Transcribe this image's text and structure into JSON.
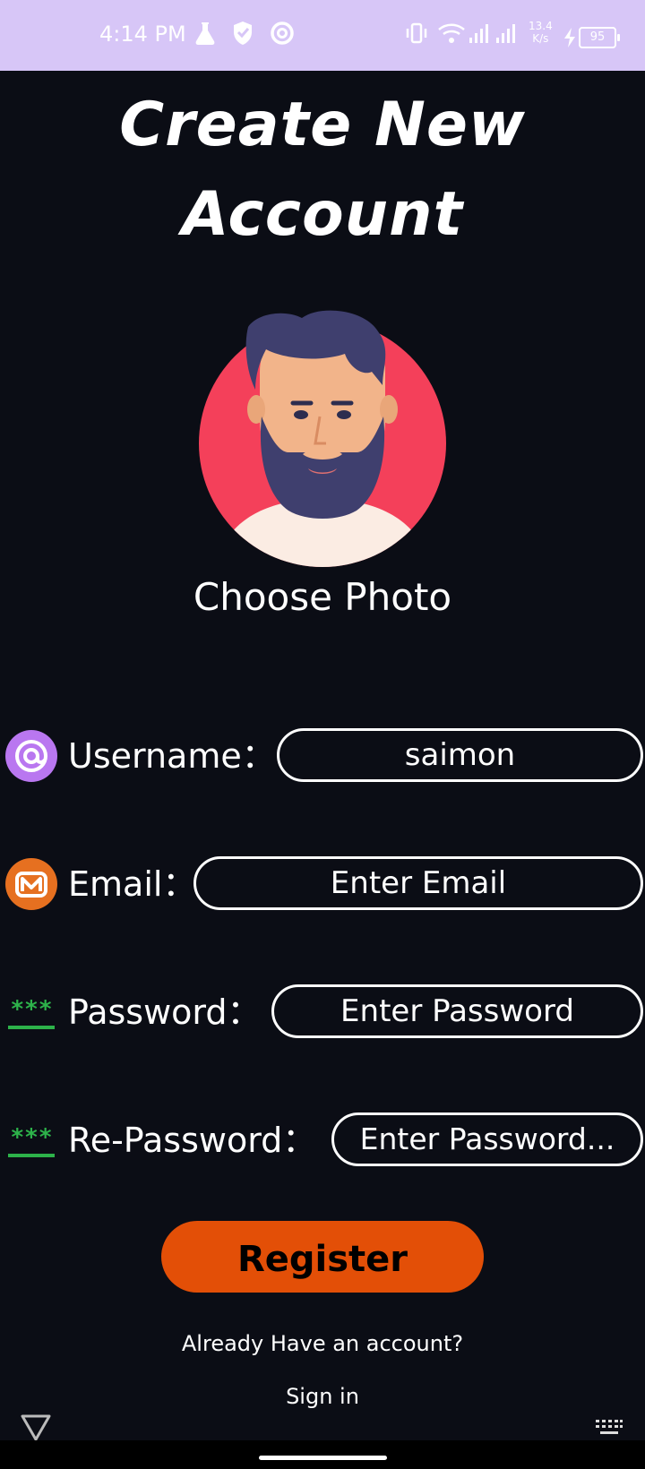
{
  "status_bar": {
    "time": "4:14 PM",
    "speed_value": "13.4",
    "speed_unit": "K/s",
    "battery": "95"
  },
  "title": {
    "line1": "Create  New",
    "line2": "Account"
  },
  "photo": {
    "label": "Choose Photo"
  },
  "form": {
    "username": {
      "label": "Username：",
      "value": "saimon"
    },
    "email": {
      "label": "Email：",
      "placeholder": "Enter Email"
    },
    "password": {
      "label": "Password：",
      "placeholder": "Enter Password"
    },
    "repassword": {
      "label": "Re-Password：",
      "placeholder": "Enter Password..."
    }
  },
  "actions": {
    "register": "Register",
    "already": "Already Have an account?",
    "signin": "Sign in"
  },
  "colors": {
    "status_bar": "#d7c6f7",
    "background": "#0b0d15",
    "register_button": "#e34f07",
    "avatar_circle": "#f4405a",
    "password_icon": "#2db24a"
  },
  "icons": [
    "flask-icon",
    "shield-icon",
    "at-circle-icon",
    "vibrate-icon",
    "wifi-icon",
    "signal-icon",
    "charging-icon",
    "battery-icon",
    "at-icon",
    "mail-icon",
    "password-icon",
    "back-icon",
    "home-pill",
    "keyboard-icon"
  ]
}
